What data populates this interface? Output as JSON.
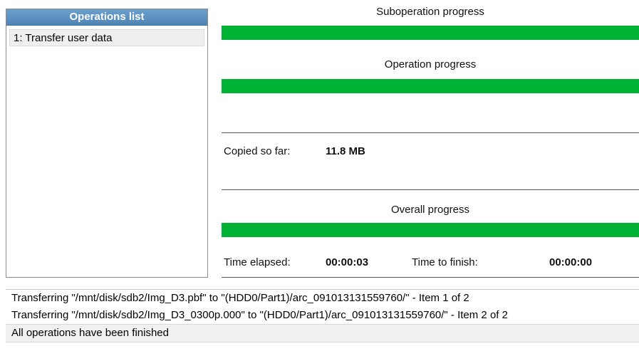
{
  "operations_list": {
    "title": "Operations list",
    "items": [
      {
        "label": "1: Transfer user data"
      }
    ]
  },
  "suboperation": {
    "label": "Suboperation progress",
    "progress_fraction": 1.0
  },
  "operation": {
    "label": "Operation progress",
    "progress_fraction": 1.0
  },
  "copied": {
    "label": "Copied so far:",
    "value": "11.8 MB"
  },
  "overall": {
    "label": "Overall progress",
    "progress_fraction": 1.0
  },
  "time": {
    "elapsed_label": "Time elapsed:",
    "elapsed_value": "00:00:03",
    "finish_label": "Time to finish:",
    "finish_value": "00:00:00"
  },
  "log": {
    "lines": [
      "Transferring \"/mnt/disk/sdb2/Img_D3.pbf\" to \"(HDD0/Part1)/arc_091013131559760/\" - Item 1 of 2",
      "Transferring \"/mnt/disk/sdb2/Img_D3_0300p.000\" to \"(HDD0/Part1)/arc_091013131559760/\" - Item 2 of 2",
      "All operations have been finished"
    ]
  },
  "colors": {
    "progress_fill": "#00b233",
    "header_bg": "#5a8fbf"
  }
}
